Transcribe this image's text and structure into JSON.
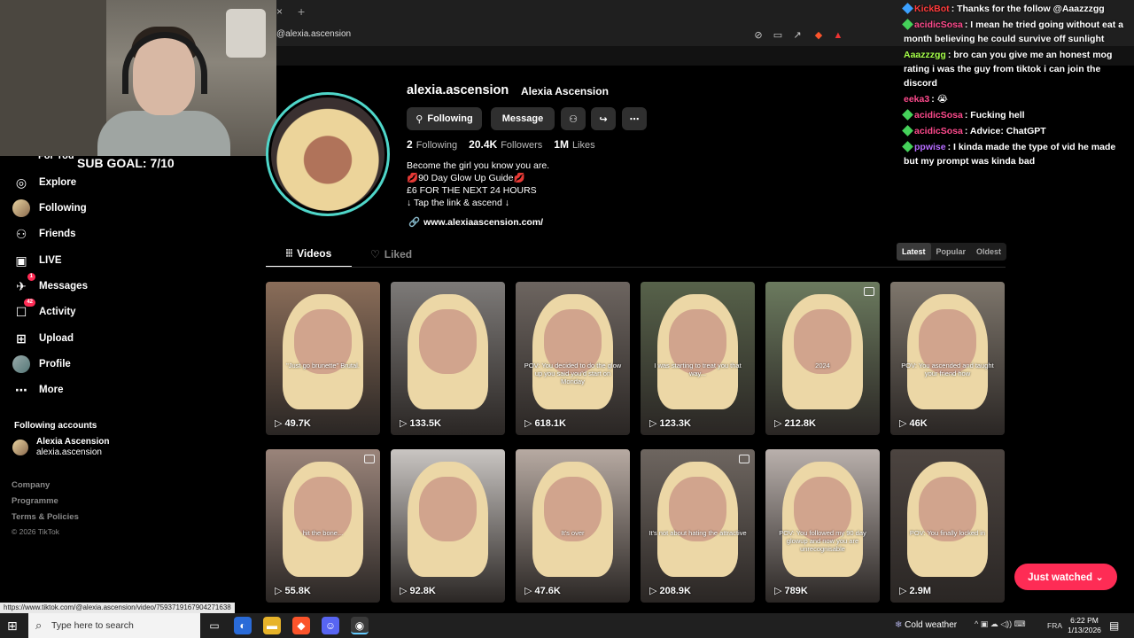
{
  "browser": {
    "url": "@alexia.ascension",
    "status_url": "https://www.tiktok.com/@alexia.ascension/video/7593719167904271638",
    "tab_close": "×",
    "tab_new": "+"
  },
  "overlay": {
    "sub_goal": "SUB GOAL: 7/10"
  },
  "sidebar": {
    "for_you": "For You",
    "items": [
      {
        "label": "Explore",
        "icon": "compass-icon",
        "glyph": "◎"
      },
      {
        "label": "Following",
        "icon": "avatar-icon",
        "glyph": ""
      },
      {
        "label": "Friends",
        "icon": "friends-icon",
        "glyph": "👥"
      },
      {
        "label": "LIVE",
        "icon": "live-icon",
        "glyph": "▣"
      },
      {
        "label": "Messages",
        "icon": "messages-icon",
        "glyph": "✈",
        "badge": "1"
      },
      {
        "label": "Activity",
        "icon": "activity-icon",
        "glyph": "☐",
        "badge": "42"
      },
      {
        "label": "Upload",
        "icon": "upload-icon",
        "glyph": "⊞"
      },
      {
        "label": "Profile",
        "icon": "profile-icon",
        "glyph": ""
      },
      {
        "label": "More",
        "icon": "more-icon",
        "glyph": "⋯"
      }
    ],
    "following_accounts_title": "Following accounts",
    "account": {
      "name": "Alexia Ascension",
      "handle": "alexia.ascension"
    },
    "footer": [
      "Company",
      "Programme",
      "Terms & Policies"
    ],
    "copyright": "© 2026 TikTok"
  },
  "profile": {
    "username": "alexia.ascension",
    "display_name": "Alexia Ascension",
    "following_button": "Following",
    "message_button": "Message",
    "stats": [
      {
        "value": "2",
        "label": "Following"
      },
      {
        "value": "20.4K",
        "label": "Followers"
      },
      {
        "value": "1M",
        "label": "Likes"
      }
    ],
    "bio": [
      "Become the girl you know you are.",
      "💋90 Day Glow Up Guide💋",
      "£6 FOR THE NEXT 24 HOURS",
      "↓ Tap the link & ascend ↓"
    ],
    "link": "www.alexiaascension.com/"
  },
  "tabs": {
    "videos": "Videos",
    "liked": "Liked"
  },
  "sort": {
    "options": [
      "Latest",
      "Popular",
      "Oldest"
    ],
    "selected": "Latest"
  },
  "videos": [
    {
      "views": "49.7K",
      "caption": "\"Just go brunette\" Brutal.",
      "bg": "#8a6d59",
      "photo": false
    },
    {
      "views": "133.5K",
      "caption": "",
      "bg": "#7d7a78",
      "photo": false
    },
    {
      "views": "618.1K",
      "caption": "POV: You decided to do the glow up you said you'd start on Monday",
      "bg": "#6d6560",
      "photo": false
    },
    {
      "views": "123.3K",
      "caption": "I was starting to treat you that way...",
      "bg": "#57624a",
      "photo": false
    },
    {
      "views": "212.8K",
      "caption": "2024",
      "bg": "#6b7a5e",
      "photo": true
    },
    {
      "views": "46K",
      "caption": "POV: You ascended and taught your friend how",
      "bg": "#7e766c",
      "photo": false
    },
    {
      "views": "55.8K",
      "caption": "hit the bone...",
      "bg": "#9a847a",
      "photo": true
    },
    {
      "views": "92.8K",
      "caption": "",
      "bg": "#c9c5c2",
      "photo": false
    },
    {
      "views": "47.6K",
      "caption": "It's over",
      "bg": "#b7aaa2",
      "photo": false
    },
    {
      "views": "208.9K",
      "caption": "It's not about hating the attractive",
      "bg": "#6e6660",
      "photo": true
    },
    {
      "views": "789K",
      "caption": "POV: You followed my 90 day glowup and now you are unrecognisable",
      "bg": "#b9b0ac",
      "photo": false
    },
    {
      "views": "2.9M",
      "caption": "POV: You finally locked in",
      "bg": "#4c4440",
      "photo": false
    }
  ],
  "chat": [
    {
      "user": "KickBot",
      "color": "#ff3b3b",
      "text": ": Thanks for the follow @Aaazzzgg",
      "badge": "#3ca1ff"
    },
    {
      "user": "acidicSosa",
      "color": "#ff4a8d",
      "text": ": I mean he tried going without eat a month believing he could survive off sunlight",
      "badge": "#45d15a"
    },
    {
      "user": "Aaazzzgg",
      "color": "#a6ff4a",
      "text": ": bro can you give me an honest mog rating i was the guy from tiktok i can join the discord",
      "badge": ""
    },
    {
      "user": "eeka3",
      "color": "#ff4a8d",
      "text": ": 😭",
      "badge": ""
    },
    {
      "user": "acidicSosa",
      "color": "#ff4a8d",
      "text": ": Fucking hell",
      "badge": "#45d15a"
    },
    {
      "user": "acidicSosa",
      "color": "#ff4a8d",
      "text": ": Advice: ChatGPT",
      "badge": "#45d15a"
    },
    {
      "user": "ppwise",
      "color": "#b56cff",
      "text": ": I kinda made the type of vid he made but my prompt was kinda bad",
      "badge": "#45d15a"
    }
  ],
  "just_watched": "Just watched ⌄",
  "taskbar": {
    "search_placeholder": "Type here to search",
    "weather": "Cold weather",
    "lang": "FRA",
    "time": "6:22 PM",
    "date": "1/13/2026"
  },
  "colors": {
    "accent": "#fe2c55",
    "ring": "#4fd6c9"
  }
}
